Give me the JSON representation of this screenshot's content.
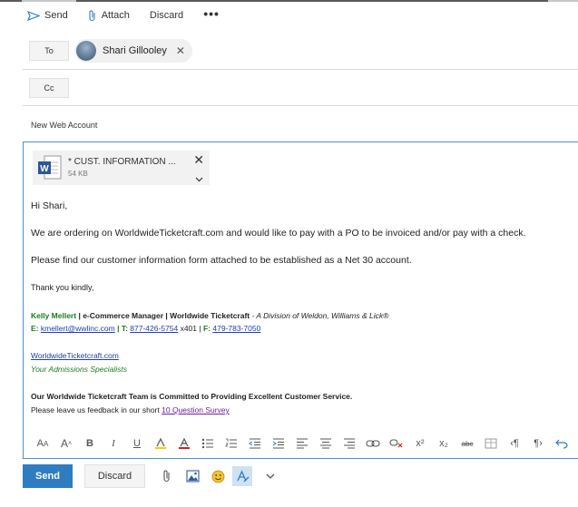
{
  "toolbar": {
    "send_label": "Send",
    "attach_label": "Attach",
    "discard_label": "Discard",
    "more_label": "•••"
  },
  "to": {
    "button_label": "To",
    "recipient_name": "Shari Gillooley",
    "remove_label": "✕"
  },
  "cc": {
    "button_label": "Cc"
  },
  "subject": "New Web Account",
  "attachment": {
    "name": "* CUST. INFORMATION ...",
    "size": "54 KB",
    "close_label": "✕"
  },
  "message": {
    "greeting": "Hi Shari,",
    "line1": "We are ordering on WorldwideTicketcraft.com and would like to pay with a PO to be invoiced and/or pay with a check.",
    "line2": "Please find our customer information form attached to be established as a Net 30 account.",
    "closing": "Thank you kindly,",
    "sig_name": "Kelly Mellert",
    "sig_sep1": " | ",
    "sig_title": "e-Commerce Manager | Worldwide Ticketcraft",
    "sig_division": " - A Division of Weldon, Williams & Lick®",
    "sig_e_label": "E:",
    "sig_email": "kmellert@wwlinc.com",
    "sig_t_label": " | T:",
    "sig_phone": "877-426-5754",
    "sig_ext": " x401 | ",
    "sig_f_label": "F:",
    "sig_fax": "479-783-7050",
    "sig_site": "WorldwideTicketcraft.com",
    "sig_tagline": "Your Admissions Specialists",
    "commit_line": "Our Worldwide Ticketcraft Team is Committed to Providing Excellent Customer Service.",
    "feedback_text": "Please leave us feedback in our short ",
    "survey_link": "10 Question Survey"
  },
  "format_bar": {
    "font_size_down": "A",
    "font_size_up": "A",
    "bold": "B",
    "italic": "I",
    "underline": "U",
    "strikethrough": "abc",
    "superscript": "x²",
    "subscript": "x₂"
  },
  "bottom": {
    "send_label": "Send",
    "discard_label": "Discard"
  },
  "colors": {
    "accent": "#2f7cc1",
    "signature_green": "#1e7b1e",
    "link": "#1f3fb0"
  }
}
